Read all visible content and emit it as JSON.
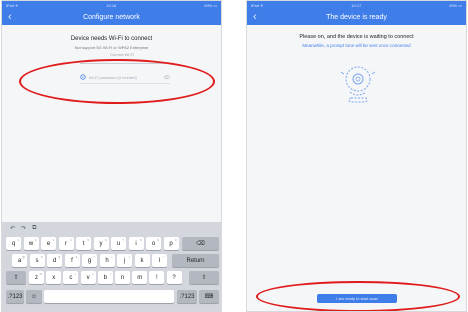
{
  "left_screen": {
    "status_left": "iPad ✈",
    "status_time": "10:16",
    "status_right": "49% ▭",
    "back_glyph": "‹",
    "title": "Configure network",
    "heading": "Device needs Wi-Fi to connect",
    "subtitle": "Not support 5G Wi-Fi or WPA2 Enterprise",
    "ssid_label": "Current Wi-Fi",
    "password_placeholder": "Wi-Fi password (if needed)",
    "wifi_icon": "wifi-icon",
    "eye_icon": "eye-icon"
  },
  "keyboard": {
    "tools": [
      "↶",
      "↷",
      "⧉"
    ],
    "row1": [
      {
        "key": "q",
        "hint": "1"
      },
      {
        "key": "w",
        "hint": "2"
      },
      {
        "key": "e",
        "hint": "3"
      },
      {
        "key": "r",
        "hint": "4"
      },
      {
        "key": "t",
        "hint": "5"
      },
      {
        "key": "y",
        "hint": "6"
      },
      {
        "key": "u",
        "hint": "7"
      },
      {
        "key": "i",
        "hint": "8"
      },
      {
        "key": "o",
        "hint": "9"
      },
      {
        "key": "p",
        "hint": "0"
      }
    ],
    "backspace": "⌫",
    "row2": [
      {
        "key": "a",
        "hint": "@"
      },
      {
        "key": "s",
        "hint": "#"
      },
      {
        "key": "d",
        "hint": "$"
      },
      {
        "key": "f",
        "hint": "&"
      },
      {
        "key": "g",
        "hint": "*"
      },
      {
        "key": "h",
        "hint": "("
      },
      {
        "key": "j",
        "hint": ")"
      },
      {
        "key": "k",
        "hint": "'"
      },
      {
        "key": "l",
        "hint": "\""
      }
    ],
    "return_label": "Return",
    "row3": [
      {
        "key": "z",
        "hint": "%"
      },
      {
        "key": "x",
        "hint": "-"
      },
      {
        "key": "c",
        "hint": "+"
      },
      {
        "key": "v",
        "hint": "="
      },
      {
        "key": "b",
        "hint": "/"
      },
      {
        "key": "n",
        "hint": ";"
      },
      {
        "key": "m",
        "hint": ":"
      },
      {
        "key": "!",
        "hint": ","
      },
      {
        "key": "?",
        "hint": "."
      }
    ],
    "shift": "⇧",
    "numbers": ".?123",
    "emoji": "☺",
    "hide": "⌨"
  },
  "right_screen": {
    "status_left": "iPad ✈",
    "status_time": "10:17",
    "status_right": "49% ▭",
    "back_glyph": "‹",
    "title": "The device is ready",
    "heading": "Please on, and the device is waiting to connect",
    "subtitle": "Meanwhile, a prompt tone will be sent once connected",
    "button_label": "I am ready to start scan",
    "camera_icon": "camera-icon"
  },
  "annotations": {
    "color": "#e01b1b"
  }
}
